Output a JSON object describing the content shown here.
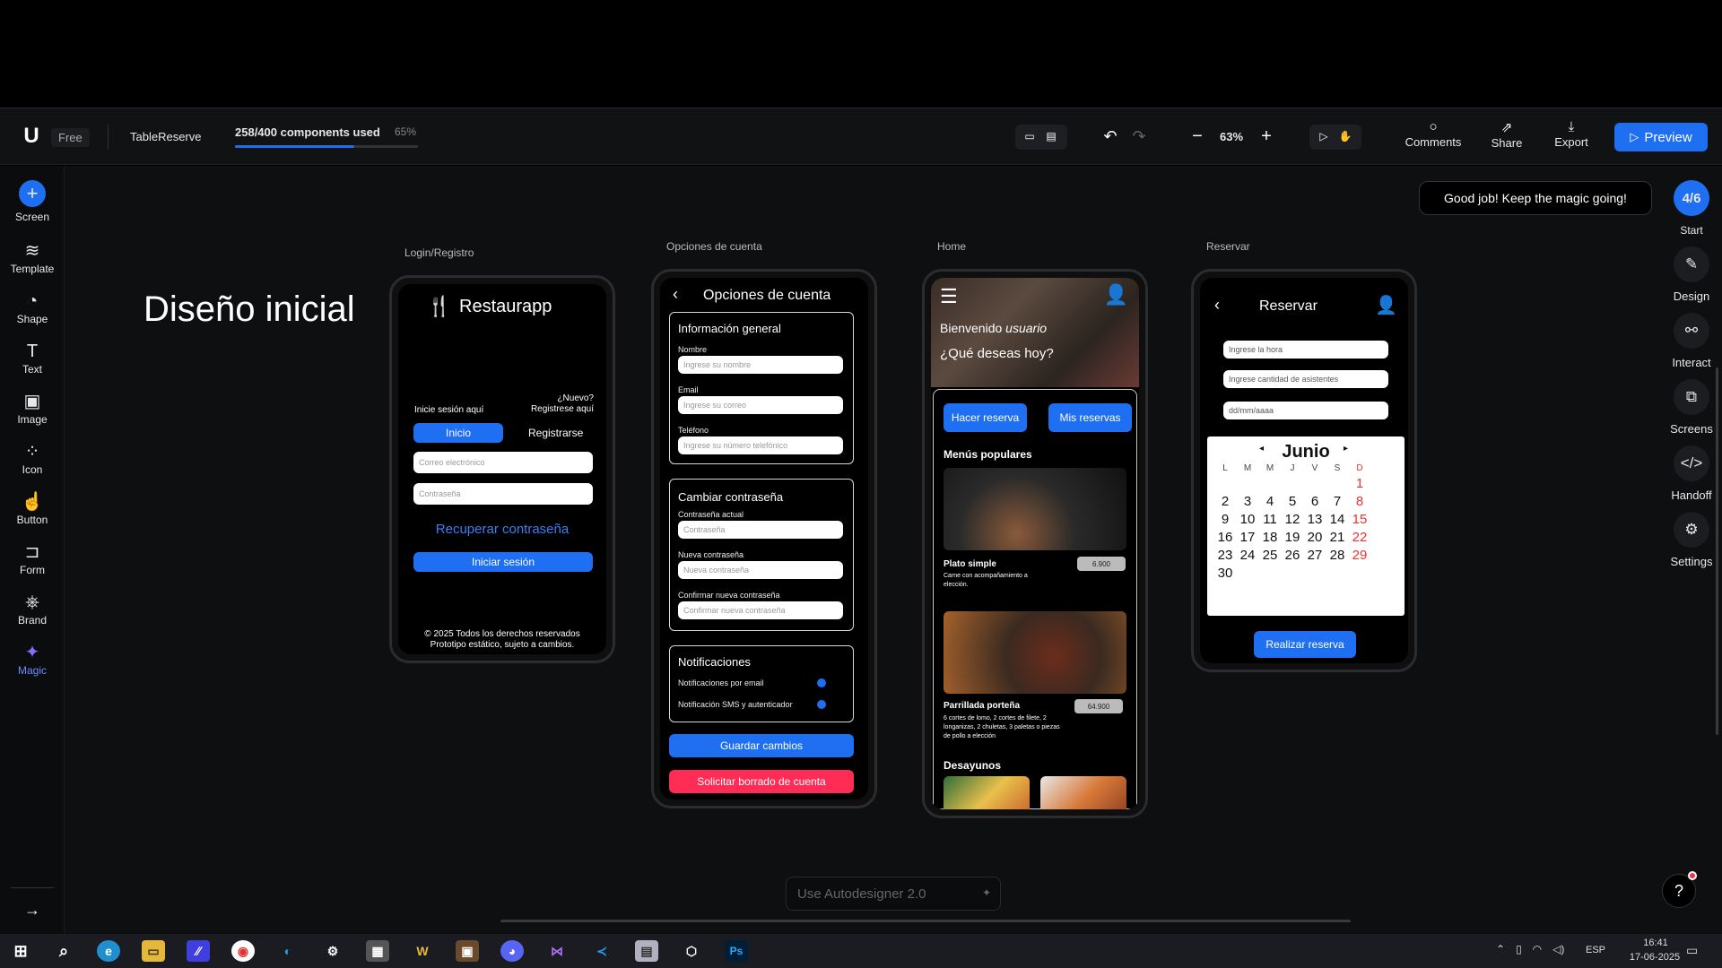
{
  "topbar": {
    "plan": "Free",
    "project": "TableReserve",
    "usage": "258/400 components used",
    "usage_pct": "65%",
    "usage_fraction": 0.65,
    "zoom": "63%",
    "comments": "Comments",
    "share": "Share",
    "export": "Export",
    "preview": "Preview"
  },
  "leftbar": {
    "items": [
      "Screen",
      "Template",
      "Shape",
      "Text",
      "Image",
      "Icon",
      "Button",
      "Form",
      "Brand",
      "Magic"
    ]
  },
  "rightbar": {
    "progress": "4/6",
    "start": "Start",
    "items": [
      "Design",
      "Interact",
      "Screens",
      "Handoff",
      "Settings"
    ]
  },
  "toast": "Good job! Keep the magic going!",
  "canvas": {
    "heading": "Diseño inicial",
    "autodesigner_placeholder": "Use Autodesigner 2.0"
  },
  "login": {
    "frame_label": "Login/Registro",
    "app_name": "Restaurapp",
    "login_hint": "Inicie sesión aquí",
    "new_hint_1": "¿Nuevo?",
    "new_hint_2": "Registrese aquí",
    "tab_login": "Inicio",
    "tab_register": "Registrarse",
    "email_placeholder": "Correo electrónico",
    "password_placeholder": "Contraseña",
    "recover": "Recuperar contraseña",
    "submit": "Iniciar sesión",
    "footer_1": "© 2025 Todos los derechos reservados",
    "footer_2": "Prototipo estático, sujeto a cambios."
  },
  "account": {
    "frame_label": "Opciones de cuenta",
    "title": "Opciones de cuenta",
    "general_title": "Información general",
    "name_label": "Nombre",
    "name_placeholder": "Ingrese su nombre",
    "email_label": "Email",
    "email_placeholder": "Ingrese su correo",
    "phone_label": "Teléfono",
    "phone_placeholder": "Ingrese su número telefónico",
    "password_title": "Cambiar contraseña",
    "current_label": "Contraseña actual",
    "current_placeholder": "Contraseña",
    "new_label": "Nueva contraseña",
    "new_placeholder": "Nueva contraseña",
    "confirm_label": "Confirmar nueva contraseña",
    "confirm_placeholder": "Confirmar nueva contraseña",
    "notif_title": "Notificaciones",
    "notif_email": "Notificaciones por email",
    "notif_sms": "Notificación SMS y autenticador",
    "save": "Guardar cambios",
    "delete": "Solicitar borrado de cuenta"
  },
  "home": {
    "frame_label": "Home",
    "welcome": "Bienvenido",
    "user": "usuario",
    "question": "¿Qué deseas hoy?",
    "btn_reserve": "Hacer reserva",
    "btn_mine": "Mis reservas",
    "popular": "Menús populares",
    "item1_name": "Plato simple",
    "item1_price": "6.900",
    "item1_desc": "Carne con acompañamiento a elección.",
    "item2_name": "Parrillada porteña",
    "item2_price": "64.900",
    "item2_desc": "6 cortes de lomo, 2 cortes de filete, 2 longanizas, 2 chuletas, 3 paletas o piezas de pollo a elección",
    "breakfast": "Desayunos"
  },
  "reserve": {
    "frame_label": "Reservar",
    "title": "Reservar",
    "time_placeholder": "Ingrese la hora",
    "guests_placeholder": "Ingrese cantidad de asistentes",
    "date_placeholder": "dd/mm/aaaa",
    "month": "Junio",
    "weekdays": [
      "L",
      "M",
      "M",
      "J",
      "V",
      "S",
      "D"
    ],
    "submit": "Realizar reserva"
  },
  "taskbar": {
    "lang": "ESP",
    "time": "16:41",
    "date": "17-06-2025"
  },
  "colors": {
    "accent": "#1e6ff1",
    "danger": "#ff2d55",
    "sunday": "#e33333"
  }
}
